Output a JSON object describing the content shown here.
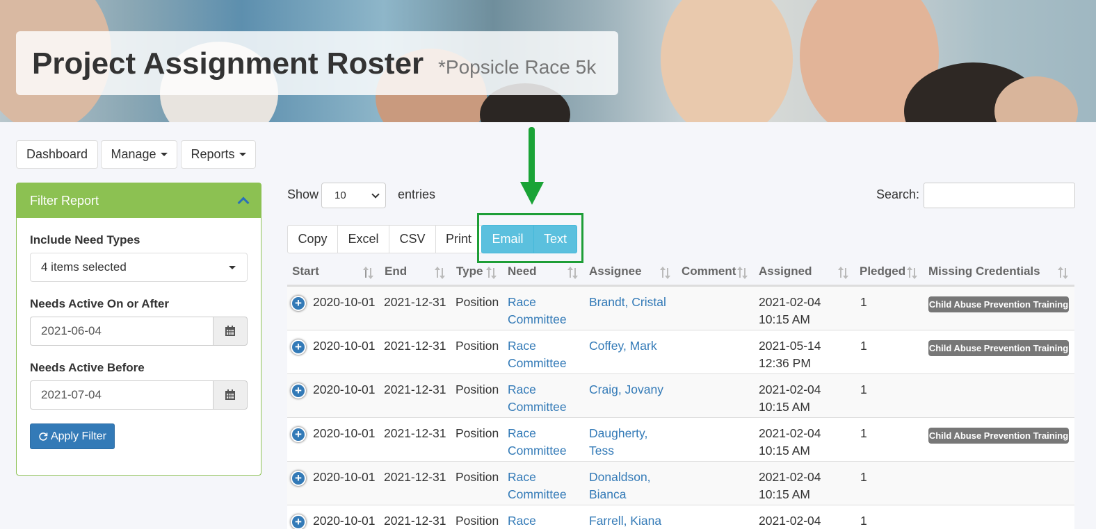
{
  "header": {
    "title": "Project Assignment Roster",
    "subtitle": "*Popsicle Race 5k"
  },
  "nav": {
    "dashboard": "Dashboard",
    "manage": "Manage",
    "reports": "Reports"
  },
  "filter": {
    "title": "Filter Report",
    "need_types_label": "Include Need Types",
    "need_types_value": "4 items selected",
    "active_after_label": "Needs Active On or After",
    "active_after_value": "2021-06-04",
    "active_before_label": "Needs Active Before",
    "active_before_value": "2021-07-04",
    "apply_label": "Apply Filter"
  },
  "controls": {
    "show_label": "Show",
    "page_length": "10",
    "entries_label": "entries",
    "search_label": "Search:"
  },
  "export_buttons": {
    "copy": "Copy",
    "excel": "Excel",
    "csv": "CSV",
    "print": "Print",
    "email": "Email",
    "text": "Text"
  },
  "table": {
    "headers": [
      "Start",
      "End",
      "Type",
      "Need",
      "Assignee",
      "Comment",
      "Assigned",
      "Pledged",
      "Missing Credentials"
    ],
    "rows": [
      {
        "start": "2020-10-01",
        "end": "2021-12-31",
        "type": "Position",
        "need1": "Race",
        "need2": "Committee",
        "assignee1": "Brandt, Cristal",
        "assignee2": "",
        "assigned1": "2021-02-04",
        "assigned2": "10:15 AM",
        "pledged": "1",
        "credential": "Child Abuse Prevention Training"
      },
      {
        "start": "2020-10-01",
        "end": "2021-12-31",
        "type": "Position",
        "need1": "Race",
        "need2": "Committee",
        "assignee1": "Coffey, Mark",
        "assignee2": "",
        "assigned1": "2021-05-14",
        "assigned2": "12:36 PM",
        "pledged": "1",
        "credential": "Child Abuse Prevention Training"
      },
      {
        "start": "2020-10-01",
        "end": "2021-12-31",
        "type": "Position",
        "need1": "Race",
        "need2": "Committee",
        "assignee1": "Craig, Jovany",
        "assignee2": "",
        "assigned1": "2021-02-04",
        "assigned2": "10:15 AM",
        "pledged": "1",
        "credential": ""
      },
      {
        "start": "2020-10-01",
        "end": "2021-12-31",
        "type": "Position",
        "need1": "Race",
        "need2": "Committee",
        "assignee1": "Daugherty,",
        "assignee2": "Tess",
        "assigned1": "2021-02-04",
        "assigned2": "10:15 AM",
        "pledged": "1",
        "credential": "Child Abuse Prevention Training"
      },
      {
        "start": "2020-10-01",
        "end": "2021-12-31",
        "type": "Position",
        "need1": "Race",
        "need2": "Committee",
        "assignee1": "Donaldson,",
        "assignee2": "Bianca",
        "assigned1": "2021-02-04",
        "assigned2": "10:15 AM",
        "pledged": "1",
        "credential": ""
      },
      {
        "start": "2020-10-01",
        "end": "2021-12-31",
        "type": "Position",
        "need1": "Race",
        "need2": "",
        "assignee1": "Farrell, Kiana",
        "assignee2": "",
        "assigned1": "2021-02-04",
        "assigned2": "",
        "pledged": "1",
        "credential": ""
      }
    ]
  }
}
